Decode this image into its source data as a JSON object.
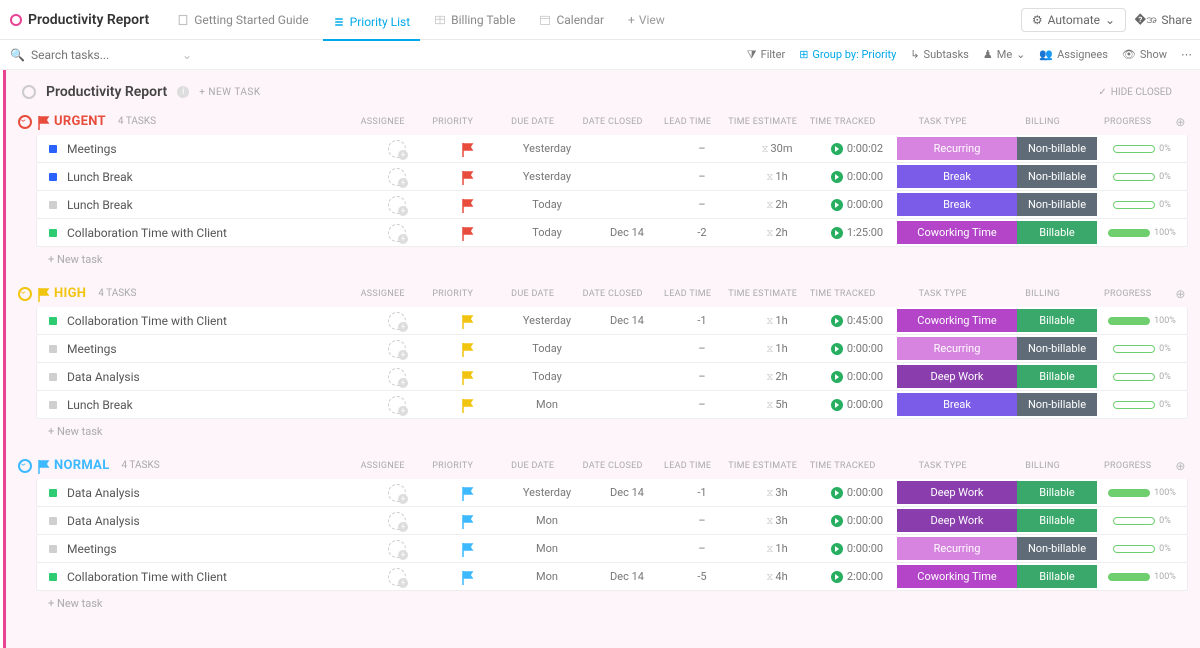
{
  "header": {
    "title": "Productivity Report",
    "tabs": [
      {
        "label": "Getting Started Guide",
        "active": false
      },
      {
        "label": "Priority List",
        "active": true
      },
      {
        "label": "Billing Table",
        "active": false
      },
      {
        "label": "Calendar",
        "active": false
      }
    ],
    "add_view": "View",
    "automate": "Automate",
    "share": "Share"
  },
  "search": {
    "placeholder": "Search tasks..."
  },
  "filters": {
    "filter": "Filter",
    "groupby": "Group by: Priority",
    "subtasks": "Subtasks",
    "me": "Me",
    "assignees": "Assignees",
    "show": "Show"
  },
  "report": {
    "title": "Productivity Report",
    "new_task": "+ NEW TASK",
    "hide_closed": "HIDE CLOSED"
  },
  "columns": [
    "ASSIGNEE",
    "PRIORITY",
    "DUE DATE",
    "DATE CLOSED",
    "LEAD TIME",
    "TIME ESTIMATE",
    "TIME TRACKED",
    "TASK TYPE",
    "BILLING",
    "PROGRESS"
  ],
  "groups": [
    {
      "name": "URGENT",
      "count": "4 TASKS",
      "color": "#e74c3c",
      "flag": "#e74c3c",
      "tasks": [
        {
          "sq": "#2962ff",
          "name": "Meetings",
          "flag": "#e74c3c",
          "due": "Yesterday",
          "due_cls": "due-yesterday",
          "closed": "",
          "lead": "–",
          "est": "30m",
          "tracked": "0:00:02",
          "type": "Recurring",
          "type_cls": "recurring",
          "billing": "Non-billable",
          "bill_cls": "nonbill",
          "progress": "0%",
          "pfull": false
        },
        {
          "sq": "#2962ff",
          "name": "Lunch Break",
          "flag": "#e74c3c",
          "due": "Yesterday",
          "due_cls": "due-yesterday",
          "closed": "",
          "lead": "–",
          "est": "1h",
          "tracked": "0:00:00",
          "type": "Break",
          "type_cls": "break",
          "billing": "Non-billable",
          "bill_cls": "nonbill",
          "progress": "0%",
          "pfull": false
        },
        {
          "sq": "#cfcfcf",
          "name": "Lunch Break",
          "flag": "#e74c3c",
          "due": "Today",
          "due_cls": "due-today",
          "closed": "",
          "lead": "–",
          "est": "2h",
          "tracked": "0:00:00",
          "type": "Break",
          "type_cls": "break",
          "billing": "Non-billable",
          "bill_cls": "nonbill",
          "progress": "0%",
          "pfull": false
        },
        {
          "sq": "#2ecc71",
          "name": "Collaboration Time with Client",
          "flag": "#e74c3c",
          "due": "Today",
          "due_cls": "due-today",
          "closed": "Dec 14",
          "lead": "-2",
          "est": "2h",
          "tracked": "1:25:00",
          "type": "Coworking Time",
          "type_cls": "coworking",
          "billing": "Billable",
          "bill_cls": "bill",
          "progress": "100%",
          "pfull": true
        }
      ]
    },
    {
      "name": "HIGH",
      "count": "4 TASKS",
      "color": "#f1c40f",
      "flag": "#f1c40f",
      "tasks": [
        {
          "sq": "#2ecc71",
          "name": "Collaboration Time with Client",
          "flag": "#f1c40f",
          "due": "Yesterday",
          "due_cls": "due-yesterday",
          "closed": "Dec 14",
          "lead": "-1",
          "est": "1h",
          "tracked": "0:45:00",
          "type": "Coworking Time",
          "type_cls": "coworking",
          "billing": "Billable",
          "bill_cls": "bill",
          "progress": "100%",
          "pfull": true
        },
        {
          "sq": "#cfcfcf",
          "name": "Meetings",
          "flag": "#f1c40f",
          "due": "Today",
          "due_cls": "due-today",
          "closed": "",
          "lead": "–",
          "est": "1h",
          "tracked": "0:00:00",
          "type": "Recurring",
          "type_cls": "recurring",
          "billing": "Non-billable",
          "bill_cls": "nonbill",
          "progress": "0%",
          "pfull": false
        },
        {
          "sq": "#cfcfcf",
          "name": "Data Analysis",
          "flag": "#f1c40f",
          "due": "Today",
          "due_cls": "due-today",
          "closed": "",
          "lead": "–",
          "est": "2h",
          "tracked": "0:00:00",
          "type": "Deep Work",
          "type_cls": "deepwork",
          "billing": "Billable",
          "bill_cls": "bill",
          "progress": "0%",
          "pfull": false
        },
        {
          "sq": "#cfcfcf",
          "name": "Lunch Break",
          "flag": "#f1c40f",
          "due": "Mon",
          "due_cls": "due-mon",
          "closed": "",
          "lead": "–",
          "est": "5h",
          "tracked": "0:00:00",
          "type": "Break",
          "type_cls": "break",
          "billing": "Non-billable",
          "bill_cls": "nonbill",
          "progress": "0%",
          "pfull": false
        }
      ]
    },
    {
      "name": "NORMAL",
      "count": "4 TASKS",
      "color": "#3db9ff",
      "flag": "#3db9ff",
      "tasks": [
        {
          "sq": "#2ecc71",
          "name": "Data Analysis",
          "flag": "#3db9ff",
          "due": "Yesterday",
          "due_cls": "due-yesterday",
          "closed": "Dec 14",
          "lead": "-1",
          "est": "3h",
          "tracked": "0:00:00",
          "type": "Deep Work",
          "type_cls": "deepwork",
          "billing": "Billable",
          "bill_cls": "bill",
          "progress": "100%",
          "pfull": true
        },
        {
          "sq": "#cfcfcf",
          "name": "Data Analysis",
          "flag": "#3db9ff",
          "due": "Mon",
          "due_cls": "due-mon",
          "closed": "",
          "lead": "–",
          "est": "3h",
          "tracked": "0:00:00",
          "type": "Deep Work",
          "type_cls": "deepwork",
          "billing": "Billable",
          "bill_cls": "bill",
          "progress": "0%",
          "pfull": false
        },
        {
          "sq": "#cfcfcf",
          "name": "Meetings",
          "flag": "#3db9ff",
          "due": "Mon",
          "due_cls": "due-mon",
          "closed": "",
          "lead": "–",
          "est": "1h",
          "tracked": "0:00:00",
          "type": "Recurring",
          "type_cls": "recurring",
          "billing": "Non-billable",
          "bill_cls": "nonbill",
          "progress": "0%",
          "pfull": false
        },
        {
          "sq": "#2ecc71",
          "name": "Collaboration Time with Client",
          "flag": "#3db9ff",
          "due": "Mon",
          "due_cls": "due-mon-g",
          "closed": "Dec 14",
          "lead": "-5",
          "est": "4h",
          "tracked": "2:00:00",
          "type": "Coworking Time",
          "type_cls": "coworking",
          "billing": "Billable",
          "bill_cls": "bill",
          "progress": "100%",
          "pfull": true
        }
      ]
    }
  ],
  "new_task_row": "+ New task"
}
